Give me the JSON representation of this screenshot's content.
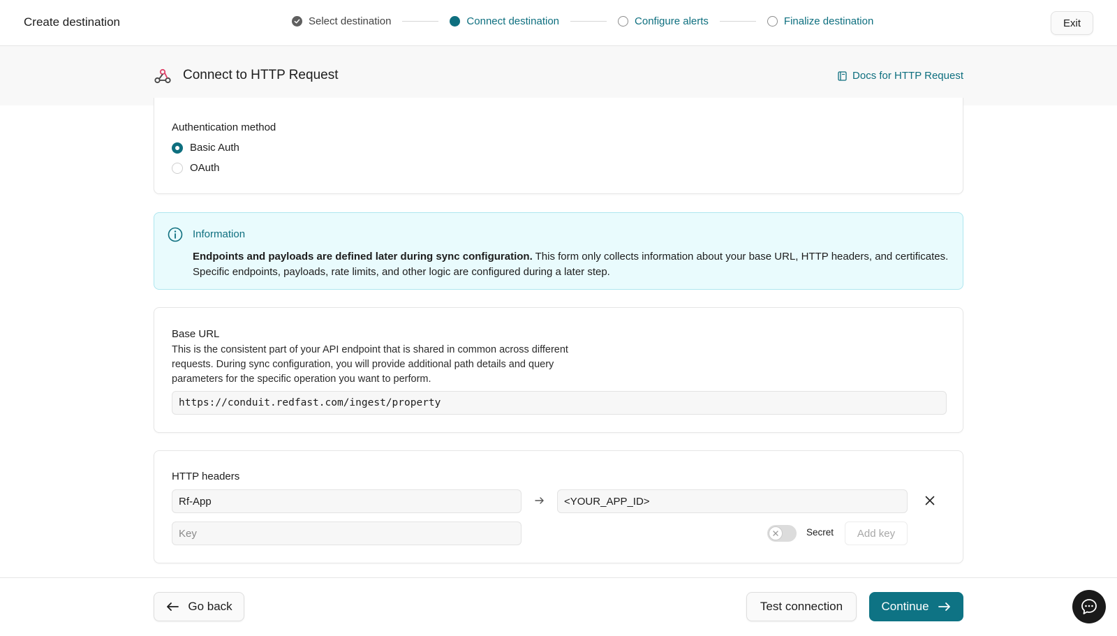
{
  "topbar": {
    "title": "Create destination",
    "exit_label": "Exit",
    "steps": [
      {
        "label": "Select destination",
        "state": "done"
      },
      {
        "label": "Connect destination",
        "state": "active"
      },
      {
        "label": "Configure alerts",
        "state": "todo"
      },
      {
        "label": "Finalize destination",
        "state": "todo"
      }
    ]
  },
  "subheader": {
    "title": "Connect to HTTP Request",
    "docs_label": "Docs for HTTP Request",
    "icon": "webhook-icon"
  },
  "auth": {
    "label": "Authentication method",
    "options": [
      {
        "label": "Basic Auth",
        "selected": true
      },
      {
        "label": "OAuth",
        "selected": false
      }
    ]
  },
  "info": {
    "title": "Information",
    "bold": "Endpoints and payloads are defined later during sync configuration.",
    "text": " This form only collects information about your base URL, HTTP headers, and certificates. Specific endpoints, payloads, rate limits, and other logic are configured during a later step."
  },
  "base_url": {
    "label": "Base URL",
    "description": "This is the consistent part of your API endpoint that is shared in common across different requests. During sync configuration, you will provide additional path details and query parameters for the specific operation you want to perform.",
    "value": "https://conduit.redfast.com/ingest/property"
  },
  "headers": {
    "label": "HTTP headers",
    "rows": [
      {
        "key": "Rf-App",
        "value": "<YOUR_APP_ID>"
      }
    ],
    "new_key_placeholder": "Key",
    "secret_label": "Secret",
    "secret_enabled": false,
    "add_key_label": "Add key"
  },
  "footer": {
    "back_label": "Go back",
    "test_label": "Test connection",
    "continue_label": "Continue"
  },
  "colors": {
    "accent": "#0e6f7f",
    "info_bg": "#e9fbfd",
    "info_border": "#aee6ef"
  }
}
